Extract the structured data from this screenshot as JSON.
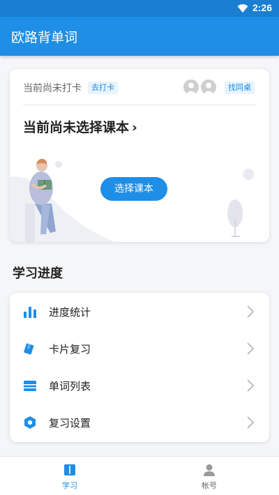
{
  "status_bar": {
    "time": "2:26"
  },
  "app_bar": {
    "title": "欧路背单词"
  },
  "course_card": {
    "checkin_status": "当前尚未打卡",
    "checkin_button": "去打卡",
    "find_partner_button": "找同桌",
    "course_title": "当前尚未选择课本",
    "course_chevron": "›",
    "select_course_button": "选择课本"
  },
  "progress_section": {
    "title": "学习进度",
    "items": [
      {
        "label": "进度统计",
        "icon": "bar-chart-icon"
      },
      {
        "label": "卡片复习",
        "icon": "cards-icon"
      },
      {
        "label": "单词列表",
        "icon": "list-icon"
      },
      {
        "label": "复习设置",
        "icon": "hexagon-settings-icon"
      }
    ]
  },
  "bottom_nav": {
    "items": [
      {
        "label": "学习",
        "icon": "book-icon",
        "active": true
      },
      {
        "label": "帐号",
        "icon": "user-icon",
        "active": false
      }
    ]
  },
  "colors": {
    "primary": "#1e8ee6",
    "status_bar": "#1a7fd0",
    "background": "#f5f6f8"
  }
}
